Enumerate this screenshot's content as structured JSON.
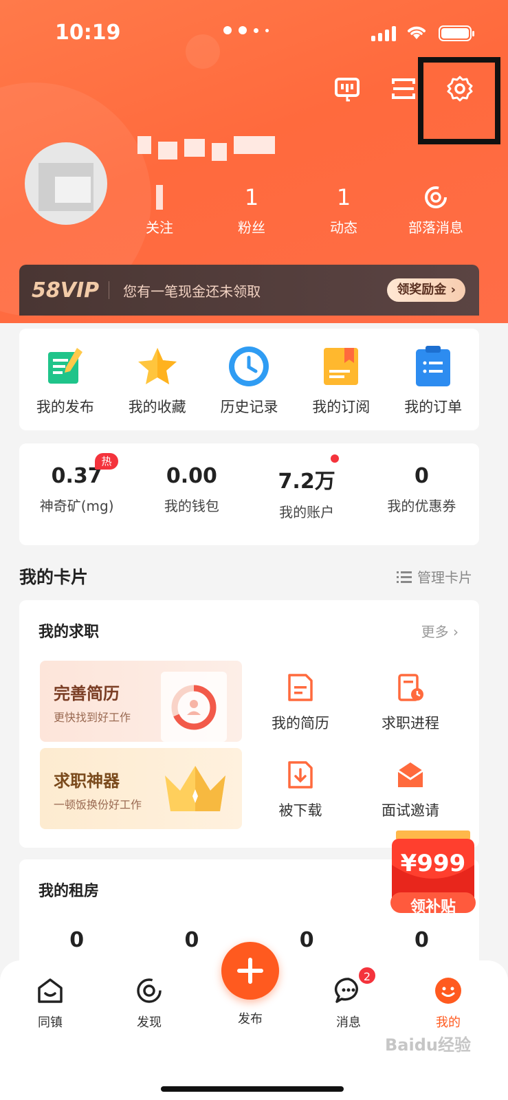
{
  "status_bar": {
    "time": "10:19"
  },
  "profile": {
    "stats": [
      {
        "value": "",
        "label": "关注"
      },
      {
        "value": "1",
        "label": "粉丝"
      },
      {
        "value": "1",
        "label": "动态"
      },
      {
        "value": "",
        "label": "部落消息"
      }
    ]
  },
  "vip": {
    "logo": "58VIP",
    "text": "您有一笔现金还未领取",
    "button": "领奖励金 ›"
  },
  "quick_actions": [
    {
      "label": "我的发布",
      "icon": "post-note-icon"
    },
    {
      "label": "我的收藏",
      "icon": "star-icon"
    },
    {
      "label": "历史记录",
      "icon": "clock-icon"
    },
    {
      "label": "我的订阅",
      "icon": "subscribe-book-icon"
    },
    {
      "label": "我的订单",
      "icon": "order-clipboard-icon"
    }
  ],
  "wallet": [
    {
      "value": "0.37",
      "label": "神奇矿(mg)",
      "badge": "热"
    },
    {
      "value": "0.00",
      "label": "我的钱包"
    },
    {
      "value": "7.2万",
      "label": "我的账户"
    },
    {
      "value": "0",
      "label": "我的优惠券"
    }
  ],
  "cards_section": {
    "title": "我的卡片",
    "manage": "管理卡片"
  },
  "job_card": {
    "title": "我的求职",
    "more": "更多 ›",
    "promos": [
      {
        "title": "完善简历",
        "subtitle": "更快找到好工作"
      },
      {
        "title": "求职神器",
        "subtitle": "一顿饭换份好工作"
      }
    ],
    "items": [
      {
        "label": "我的简历",
        "icon": "resume-icon"
      },
      {
        "label": "求职进程",
        "icon": "progress-icon"
      },
      {
        "label": "被下载",
        "icon": "download-icon"
      },
      {
        "label": "面试邀请",
        "icon": "invitation-icon"
      }
    ]
  },
  "rent_card": {
    "title": "我的租房",
    "values": [
      "0",
      "0",
      "0",
      "0"
    ]
  },
  "subsidy": {
    "amount": "¥999",
    "label": "领补贴"
  },
  "tabbar": {
    "tabs": [
      {
        "label": "同镇",
        "icon": "home-icon"
      },
      {
        "label": "发现",
        "icon": "discover-icon"
      },
      {
        "label": "发布",
        "icon": "plus-icon"
      },
      {
        "label": "消息",
        "icon": "chat-icon",
        "badge": "2"
      },
      {
        "label": "我的",
        "icon": "smile-icon"
      }
    ]
  },
  "watermark": "Baidu经验",
  "colors": {
    "accent": "#ff5a1f",
    "header": "#ff6d47",
    "vip_bg": "#4a3633",
    "badge": "#f4333c"
  }
}
